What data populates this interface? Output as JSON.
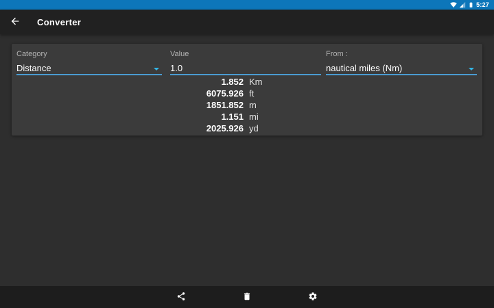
{
  "colors": {
    "status_bar": "#0d76ba",
    "accent": "#33b5e5",
    "underline": "#4a9bd1"
  },
  "status_bar": {
    "time": "5:27",
    "icons": [
      "wifi-icon",
      "signal-icon",
      "battery-icon"
    ]
  },
  "app_bar": {
    "title": "Converter",
    "back_icon": "arrow-left-icon"
  },
  "fields": {
    "category": {
      "label": "Category",
      "value": "Distance"
    },
    "value": {
      "label": "Value",
      "value": "1.0"
    },
    "from": {
      "label": "From :",
      "value": "nautical miles (Nm)"
    }
  },
  "results": [
    {
      "value": "1.852",
      "unit": "Km"
    },
    {
      "value": "6075.926",
      "unit": "ft"
    },
    {
      "value": "1851.852",
      "unit": "m"
    },
    {
      "value": "1.151",
      "unit": "mi"
    },
    {
      "value": "2025.926",
      "unit": "yd"
    }
  ],
  "bottom_bar": {
    "actions": [
      "share-icon",
      "delete-icon",
      "settings-icon"
    ]
  }
}
